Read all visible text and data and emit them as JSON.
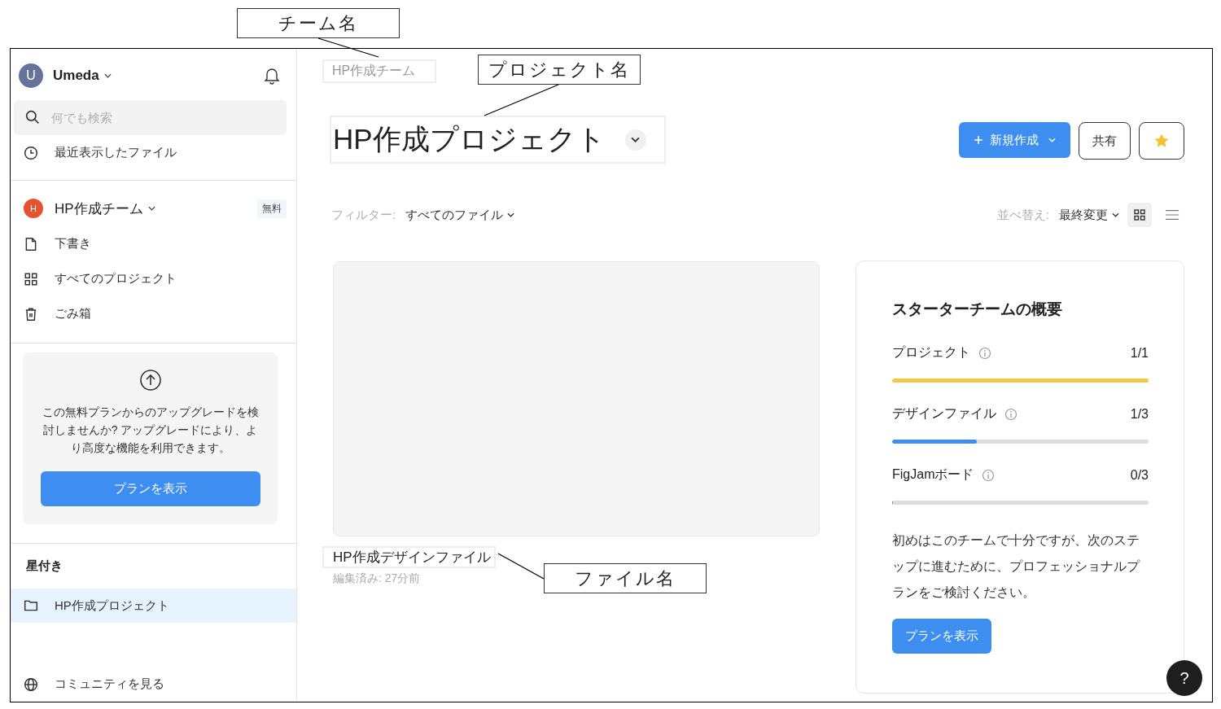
{
  "annotations": [
    {
      "label": "チーム名"
    },
    {
      "label": "プロジェクト名"
    },
    {
      "label": "ファイル名"
    }
  ],
  "sidebar": {
    "user": {
      "initial": "U",
      "name": "Umeda"
    },
    "search": {
      "placeholder": "何でも検索"
    },
    "recent": {
      "label": "最近表示したファイル"
    },
    "team": {
      "initial": "H",
      "name": "HP作成チーム",
      "badge": "無料"
    },
    "team_items": [
      {
        "kind": "drafts",
        "label": "下書き"
      },
      {
        "kind": "projects",
        "label": "すべてのプロジェクト"
      },
      {
        "kind": "trash",
        "label": "ごみ箱"
      }
    ],
    "upgrade": {
      "text": "この無料プランからのアップグレードを検討しませんか? アップグレードにより、より高度な機能を利用できます。",
      "button": "プランを表示"
    },
    "starred": {
      "heading": "星付き",
      "items": [
        {
          "label": "HP作成プロジェクト",
          "selected": true
        }
      ]
    },
    "community": {
      "label": "コミュニティを見る"
    }
  },
  "main": {
    "breadcrumb": "HP作成チーム",
    "title": "HP作成プロジェクト",
    "buttons": {
      "new": "新規作成",
      "share": "共有"
    },
    "filter": {
      "label": "フィルター:",
      "value": "すべてのファイル"
    },
    "sort": {
      "label": "並べ替え:",
      "value": "最終変更"
    },
    "view_toggles": [
      {
        "kind": "grid",
        "selected": true
      },
      {
        "kind": "list",
        "selected": false
      }
    ],
    "files": [
      {
        "name": "HP作成デザインファイル",
        "edited": "編集済み: 27分前"
      }
    ],
    "overview": {
      "title": "スターターチームの概要",
      "meters": [
        {
          "label": "プロジェクト",
          "reading": "1/1",
          "level": 1,
          "color": "#f5c945"
        },
        {
          "label": "デザインファイル",
          "reading": "1/3",
          "level": 0.33,
          "color": "#3d8ef0"
        },
        {
          "label": "FigJamボード",
          "reading": "0/3",
          "level": 0
        }
      ],
      "text": "初めはこのチームで十分ですが、次のステップに進むために、プロフェッショナルプランをご検討ください。",
      "button": "プランを表示"
    },
    "help": "?"
  }
}
